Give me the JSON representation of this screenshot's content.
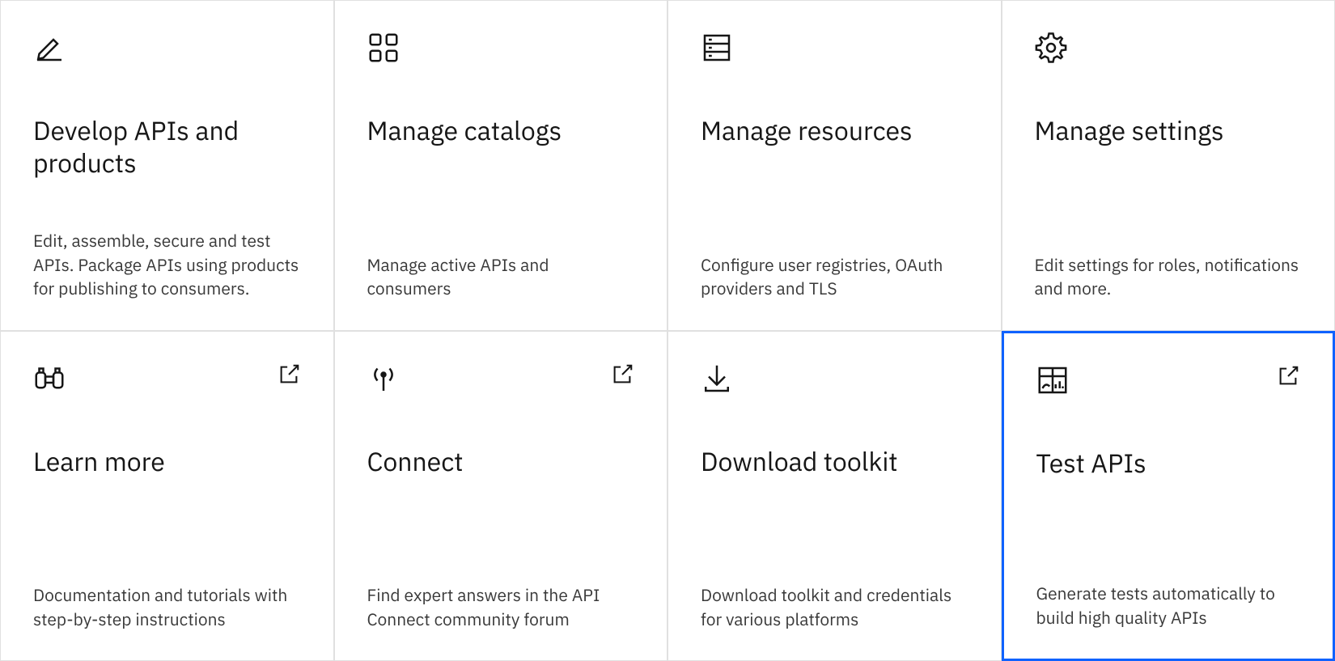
{
  "cards": [
    {
      "title": "Develop APIs and products",
      "description": "Edit, assemble, secure and test APIs. Package APIs using products for publishing to consumers."
    },
    {
      "title": "Manage catalogs",
      "description": "Manage active APIs and consumers"
    },
    {
      "title": "Manage resources",
      "description": "Configure user registries, OAuth providers and TLS"
    },
    {
      "title": "Manage settings",
      "description": "Edit settings for roles, notifications and more."
    },
    {
      "title": "Learn more",
      "description": "Documentation and tutorials with step-by-step instructions"
    },
    {
      "title": "Connect",
      "description": "Find expert answers in the API Connect community forum"
    },
    {
      "title": "Download toolkit",
      "description": "Download toolkit and credentials for various platforms"
    },
    {
      "title": "Test APIs",
      "description": "Generate tests automatically to build high quality APIs"
    }
  ]
}
